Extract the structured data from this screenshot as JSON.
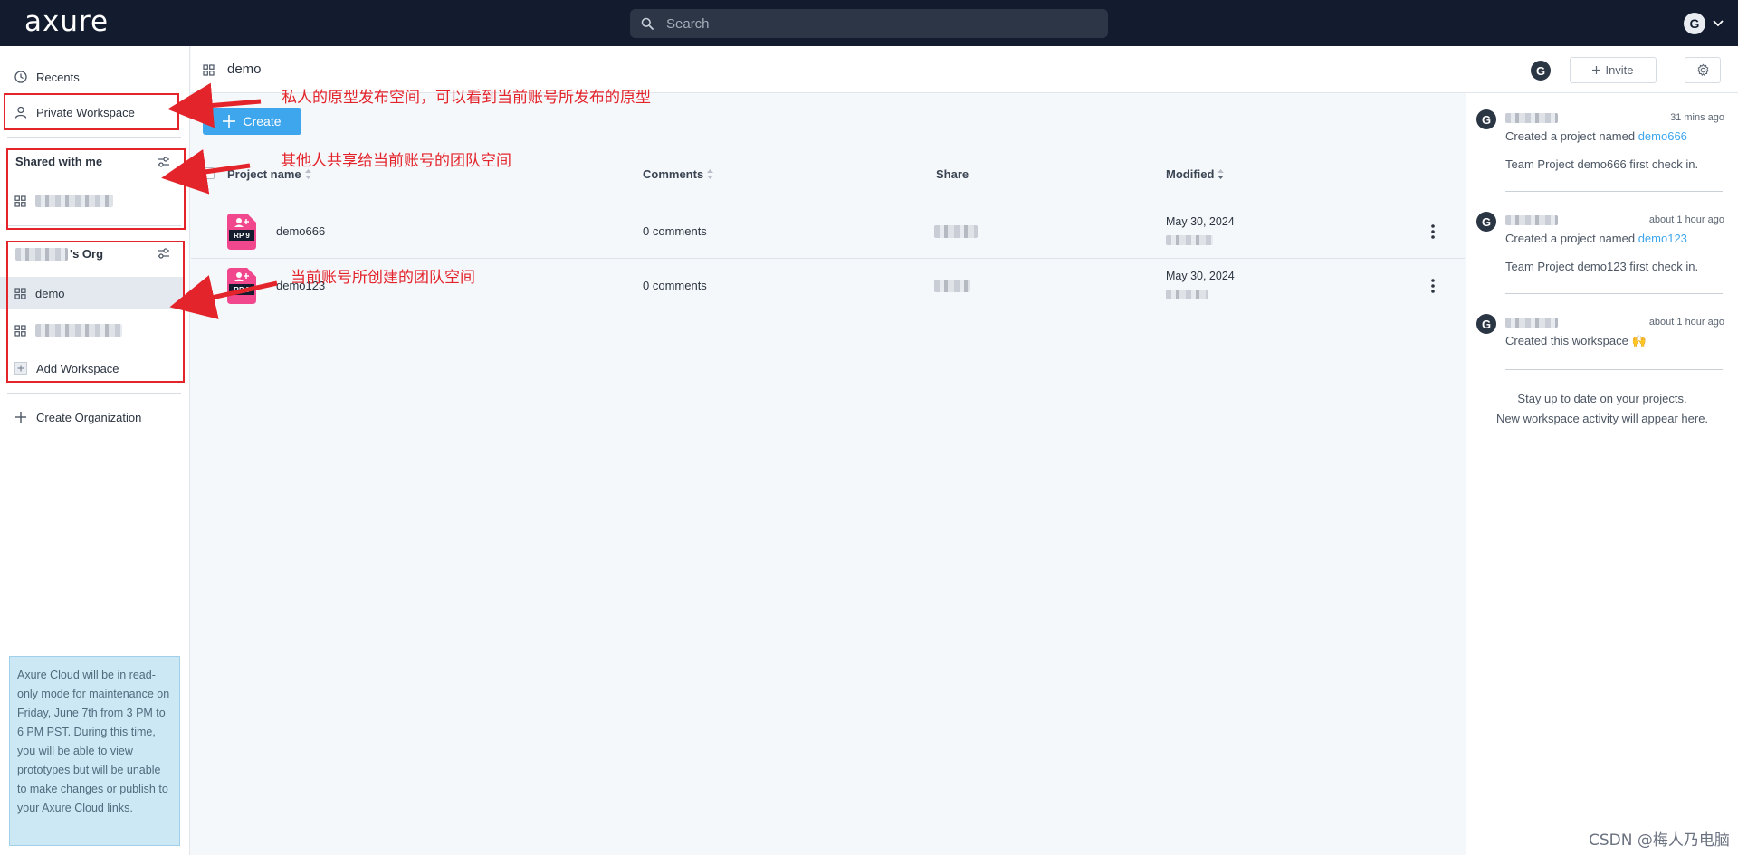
{
  "topbar": {
    "logo": "axure",
    "search_placeholder": "Search",
    "user_initial": "G"
  },
  "sidebar": {
    "recents": "Recents",
    "private_workspace": "Private Workspace",
    "shared_title": "Shared with me",
    "org_title_suffix": "'s Org",
    "demo": "demo",
    "add_workspace": "Add Workspace",
    "create_org": "Create Organization",
    "notice": "Axure Cloud will be in read-only mode for maintenance on Friday, June 7th from 3 PM to 6 PM PST. During this time, you will be able to view prototypes but will be unable to make changes or publish to your Axure Cloud links."
  },
  "header": {
    "workspace_title": "demo",
    "avatar_initial": "G",
    "invite_label": "Invite"
  },
  "main": {
    "create_label": "Create",
    "columns": {
      "name": "Project name",
      "comments": "Comments",
      "share": "Share",
      "modified": "Modified"
    },
    "rows": [
      {
        "icon_label": "RP 9",
        "name": "demo666",
        "comments": "0 comments",
        "modified": "May 30, 2024"
      },
      {
        "icon_label": "RP 9",
        "name": "demo123",
        "comments": "0 comments",
        "modified": "May 30, 2024"
      }
    ]
  },
  "activity": {
    "items": [
      {
        "initial": "G",
        "time": "31 mins ago",
        "text": "Created a project named ",
        "link": "demo666",
        "sub": "Team Project demo666 first check in."
      },
      {
        "initial": "G",
        "time": "about 1 hour ago",
        "text": "Created a project named ",
        "link": "demo123",
        "sub": "Team Project demo123 first check in."
      },
      {
        "initial": "G",
        "time": "about 1 hour ago",
        "text": "Created this workspace 🙌"
      }
    ],
    "empty_line1": "Stay up to date on your projects.",
    "empty_line2": "New workspace activity will appear here."
  },
  "annotations": {
    "a1": "私人的原型发布空间，可以看到当前账号所发布的原型",
    "a2": "其他人共享给当前账号的团队空间",
    "a3": "当前账号所创建的团队空间"
  },
  "watermark": "CSDN @梅人乃电脑",
  "colors": {
    "topbar_bg": "#121c2e",
    "accent": "#3ea6ed",
    "annotation_red": "#e3242b",
    "rp_icon": "#f0478d"
  }
}
